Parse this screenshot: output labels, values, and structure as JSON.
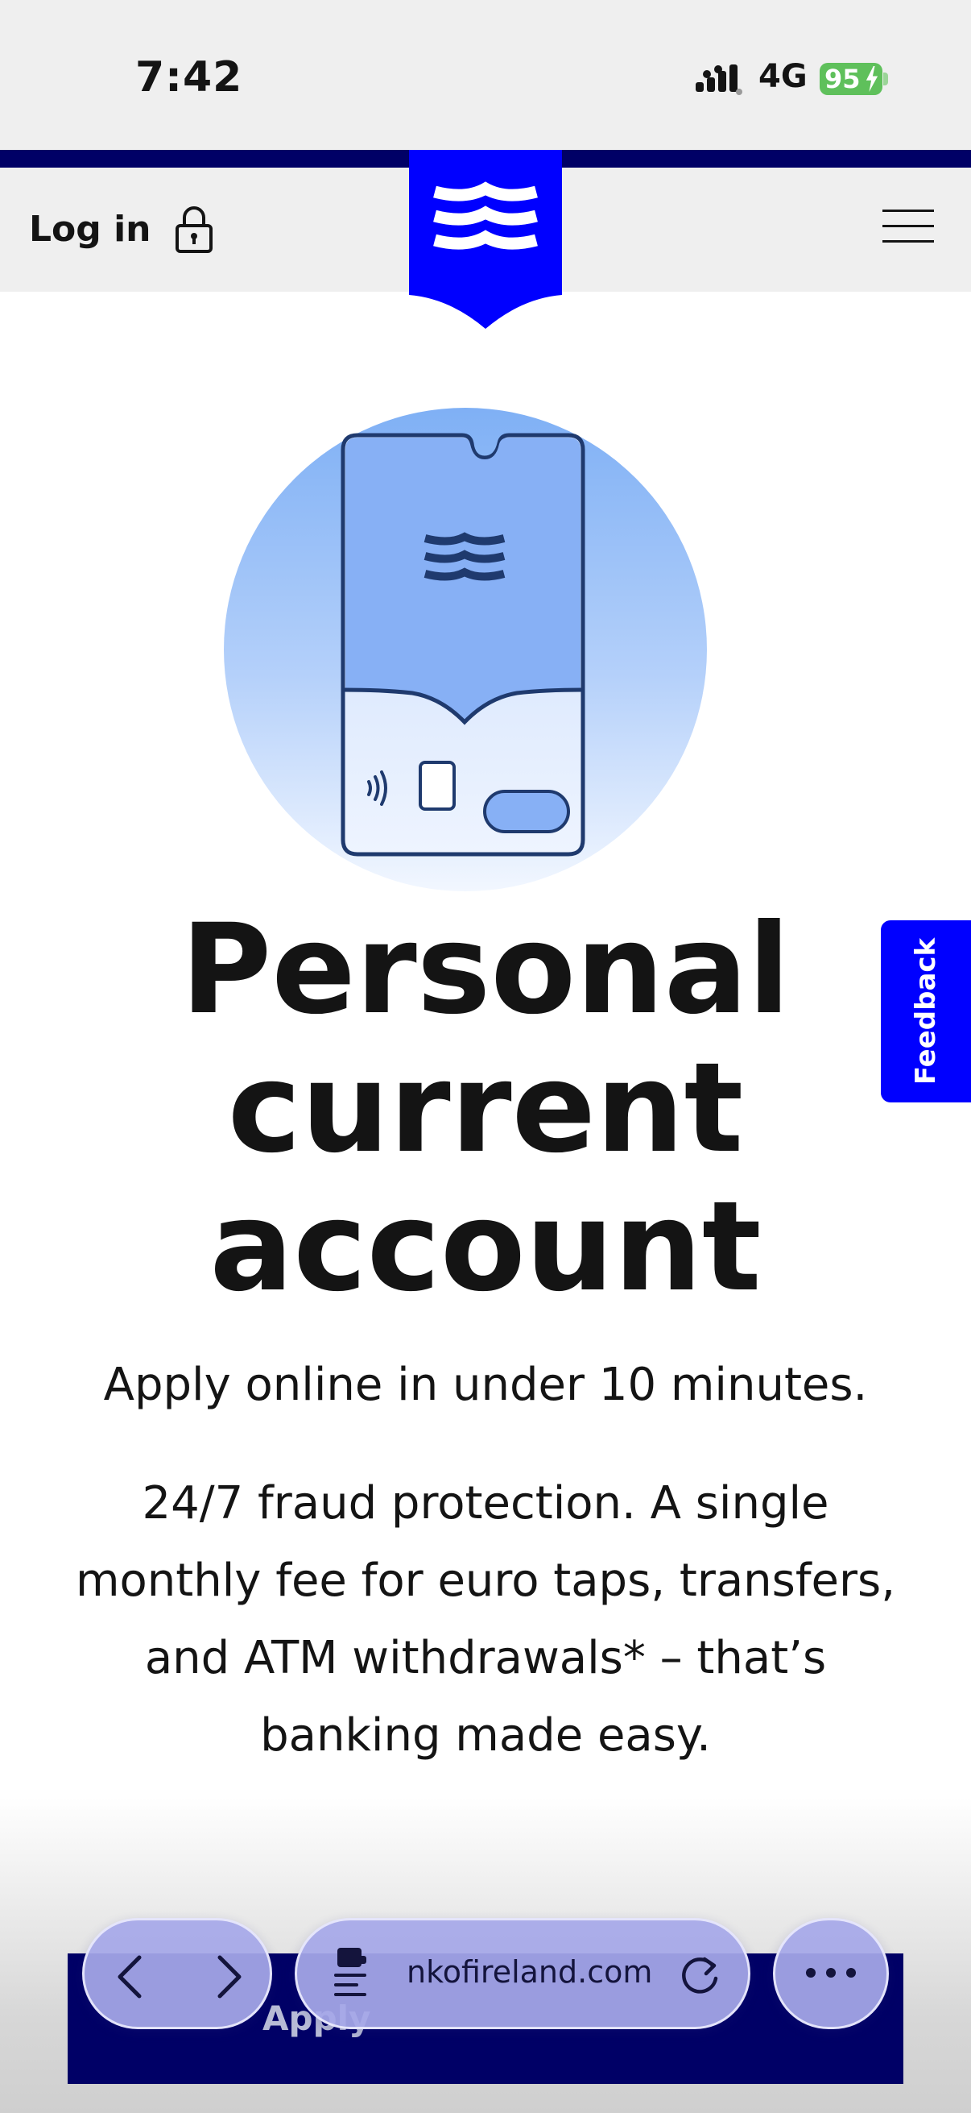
{
  "status_bar": {
    "time": "7:42",
    "network": "4G",
    "battery": "95"
  },
  "header": {
    "login_label": "Log in"
  },
  "hero": {
    "title_lines": [
      "Personal",
      "current",
      "account"
    ],
    "lead": "Apply online in under 10 minutes.",
    "body_lines": [
      "24/7 fraud protection. A single",
      "monthly fee for euro taps, transfers,",
      "and ATM withdrawals* – that’s",
      "banking made easy."
    ]
  },
  "feedback": {
    "label": "Feedback"
  },
  "cta": {
    "label": "Apply"
  },
  "browser": {
    "url_display": "nkofireland.com"
  },
  "icons": {
    "lock": "lock-icon",
    "menu": "hamburger-menu-icon",
    "logo": "bank-shield-logo",
    "back": "chevron-left-icon",
    "forward": "chevron-right-icon",
    "tabs": "tab-overview-icon",
    "reload": "reload-icon",
    "more": "more-dots-icon"
  },
  "colors": {
    "brand_blue": "#0000ff",
    "navy": "#000066",
    "battery_green": "#5fc05b",
    "toolbar_pill": "#a6a8e8",
    "card_blue": "#87b0f5"
  }
}
